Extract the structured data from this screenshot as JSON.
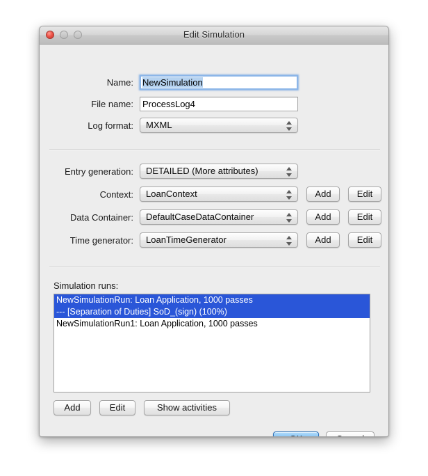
{
  "window": {
    "title": "Edit Simulation",
    "controls": {
      "close": "close-button",
      "minimize": "minimize-button",
      "zoom": "zoom-button"
    }
  },
  "form": {
    "name": {
      "label": "Name:",
      "value": "NewSimulation",
      "focused": true,
      "selected": true
    },
    "file_name": {
      "label": "File name:",
      "value": "ProcessLog4"
    },
    "log_format": {
      "label": "Log format:",
      "value": "MXML"
    },
    "entry_generation": {
      "label": "Entry generation:",
      "value": "DETAILED (More attributes)"
    },
    "context": {
      "label": "Context:",
      "value": "LoanContext",
      "add_label": "Add",
      "edit_label": "Edit"
    },
    "data_container": {
      "label": "Data Container:",
      "value": "DefaultCaseDataContainer",
      "add_label": "Add",
      "edit_label": "Edit"
    },
    "time_generator": {
      "label": "Time generator:",
      "value": "LoanTimeGenerator",
      "add_label": "Add",
      "edit_label": "Edit"
    }
  },
  "simulation_runs": {
    "label": "Simulation runs:",
    "items": [
      {
        "text": "NewSimulationRun: Loan Application, 1000 passes",
        "selected": true
      },
      {
        "text": "--- [Separation of Duties] SoD_(sign) (100%)",
        "selected": true
      },
      {
        "text": "NewSimulationRun1: Loan Application, 1000 passes",
        "selected": false
      }
    ],
    "buttons": {
      "add": "Add",
      "edit": "Edit",
      "show_activities": "Show activities"
    }
  },
  "dialog_buttons": {
    "ok": "OK",
    "cancel": "Cancel"
  },
  "colors": {
    "selection_blue": "#2a56d8",
    "default_button_blue": "#4da2ee",
    "text_selection": "#b5d2f0",
    "window_background": "#ededed"
  }
}
